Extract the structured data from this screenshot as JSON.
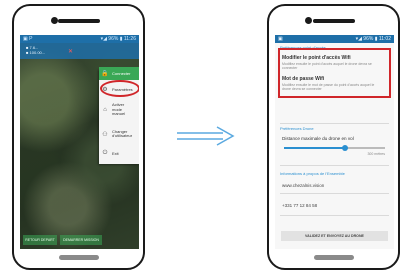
{
  "left_phone": {
    "statusbar": {
      "left": "▣ P",
      "right": "▾◢ 96% ▮ 11:26"
    },
    "appbar": {
      "info_line1": "■ 7.6...",
      "info_line2": "■ 100.00...",
      "gps": "✕"
    },
    "menu": {
      "items": [
        {
          "icon": "lock-icon",
          "glyph": "🔒",
          "label": "Connecter"
        },
        {
          "icon": "gear-icon",
          "glyph": "⚙",
          "label": "Paramètres"
        },
        {
          "icon": "home-icon",
          "glyph": "⌂",
          "label": "Activer mode manuel"
        },
        {
          "icon": "person-icon",
          "glyph": "⚇",
          "label": "Changer d'utilisateur"
        },
        {
          "icon": "power-icon",
          "glyph": "⏻",
          "label": "Exit"
        }
      ]
    },
    "bottom_buttons": [
      "RETOUR DEPART",
      "DEMARRER MISSION"
    ]
  },
  "right_phone": {
    "statusbar": {
      "left": "▣",
      "right": "▾◢ 96% ▮ 11:02"
    },
    "section_wifi": "Préférences point d'accès",
    "wifi_title": "Modifier le point d'accès Wifi",
    "wifi_desc": "Modifiez ensuite le point d'accès auquel le drone devra se connecter",
    "password_title": "Mot de passe Wifi",
    "password_desc": "Modifiez ensuite le mot de passe du point d'accès auquel le drone devra se connecter",
    "section_drone": "Préférences Drone",
    "distance_title": "Distance maximale du drone en vol",
    "distance_value_label": "300 mètres",
    "distance_fraction": 0.6,
    "section_contact": "Informations à propos de l'Ensemble",
    "website": "www.chezalnis.vision",
    "phone": "+331 77 12 84 58",
    "validate_button": "VALIDEZ ET ENVOYEZ AU DRONE"
  },
  "colors": {
    "accent_blue": "#1e6fa8",
    "link_blue": "#2a8fd0",
    "highlight_red": "#d0262a",
    "menu_green": "#3aa856",
    "arrow_blue": "#5aa9e0"
  }
}
